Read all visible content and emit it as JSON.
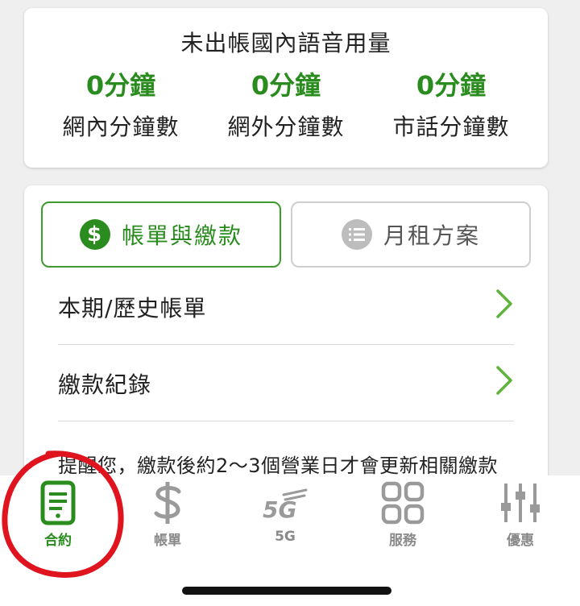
{
  "usage": {
    "title": "未出帳國內語音用量",
    "stats": [
      {
        "value": "0分鐘",
        "label": "網內分鐘數"
      },
      {
        "value": "0分鐘",
        "label": "網外分鐘數"
      },
      {
        "value": "0分鐘",
        "label": "市話分鐘數"
      }
    ]
  },
  "tabs": {
    "bill": "帳單與繳款",
    "plan": "月租方案"
  },
  "menu": {
    "bill_history": "本期/歷史帳單",
    "payment_record": "繳款紀錄"
  },
  "reminder": "提醒您，繳款後約2～3個營業日才會更新相關繳款",
  "nav": [
    {
      "label": "合約",
      "icon": "contract-icon"
    },
    {
      "label": "帳單",
      "icon": "dollar-icon"
    },
    {
      "label": "5G",
      "icon": "5g-icon"
    },
    {
      "label": "服務",
      "icon": "grid-icon"
    },
    {
      "label": "優惠",
      "icon": "sliders-icon"
    }
  ],
  "colors": {
    "accent": "#2a8c1e",
    "inactive": "#8a8a8a",
    "annotation": "#e0141e"
  }
}
